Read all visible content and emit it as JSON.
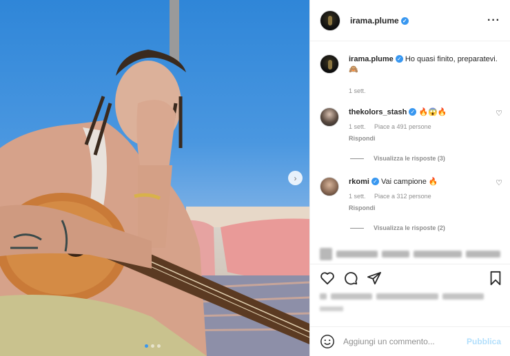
{
  "post": {
    "author": "irama.plume",
    "caption_user": "irama.plume",
    "caption_text": "Ho quasi finito, preparatevi. 🙈",
    "caption_time": "1 sett."
  },
  "comments": [
    {
      "user": "thekolors_stash",
      "text": "🔥😱🔥",
      "time": "1 sett.",
      "likes": "Piace a 491 persone",
      "reply": "Rispondi",
      "view_replies": "Visualizza le risposte (3)"
    },
    {
      "user": "rkomi",
      "text": "Vai campione 🔥",
      "time": "1 sett.",
      "likes": "Piace a 312 persone",
      "reply": "Rispondi",
      "view_replies": "Visualizza le risposte (2)"
    }
  ],
  "composer": {
    "placeholder": "Aggiungi un commento...",
    "publish_label": "Pubblica"
  },
  "icons": {
    "like": "heart-icon",
    "comment": "comment-icon",
    "share": "share-icon",
    "save": "bookmark-icon",
    "emoji": "emoji-icon",
    "more": "more-icon",
    "next": "chevron-right-icon"
  },
  "carousel": {
    "count": 3,
    "active": 1
  },
  "colors": {
    "accent": "#3897f0",
    "publish_disabled": "#b2dffc",
    "muted": "#8e8e8e"
  }
}
